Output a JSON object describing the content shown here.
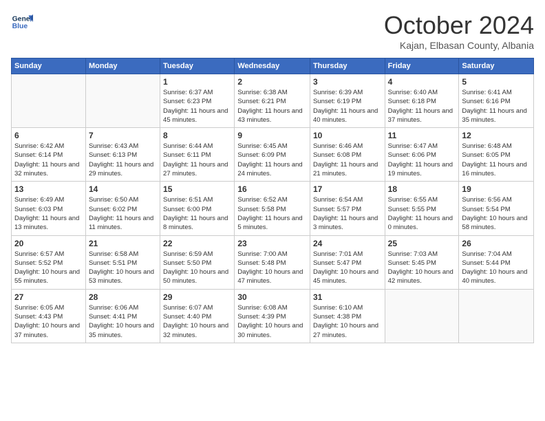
{
  "header": {
    "logo_line1": "General",
    "logo_line2": "Blue",
    "month": "October 2024",
    "location": "Kajan, Elbasan County, Albania"
  },
  "days_of_week": [
    "Sunday",
    "Monday",
    "Tuesday",
    "Wednesday",
    "Thursday",
    "Friday",
    "Saturday"
  ],
  "weeks": [
    [
      {
        "day": "",
        "detail": ""
      },
      {
        "day": "",
        "detail": ""
      },
      {
        "day": "1",
        "detail": "Sunrise: 6:37 AM\nSunset: 6:23 PM\nDaylight: 11 hours and 45 minutes."
      },
      {
        "day": "2",
        "detail": "Sunrise: 6:38 AM\nSunset: 6:21 PM\nDaylight: 11 hours and 43 minutes."
      },
      {
        "day": "3",
        "detail": "Sunrise: 6:39 AM\nSunset: 6:19 PM\nDaylight: 11 hours and 40 minutes."
      },
      {
        "day": "4",
        "detail": "Sunrise: 6:40 AM\nSunset: 6:18 PM\nDaylight: 11 hours and 37 minutes."
      },
      {
        "day": "5",
        "detail": "Sunrise: 6:41 AM\nSunset: 6:16 PM\nDaylight: 11 hours and 35 minutes."
      }
    ],
    [
      {
        "day": "6",
        "detail": "Sunrise: 6:42 AM\nSunset: 6:14 PM\nDaylight: 11 hours and 32 minutes."
      },
      {
        "day": "7",
        "detail": "Sunrise: 6:43 AM\nSunset: 6:13 PM\nDaylight: 11 hours and 29 minutes."
      },
      {
        "day": "8",
        "detail": "Sunrise: 6:44 AM\nSunset: 6:11 PM\nDaylight: 11 hours and 27 minutes."
      },
      {
        "day": "9",
        "detail": "Sunrise: 6:45 AM\nSunset: 6:09 PM\nDaylight: 11 hours and 24 minutes."
      },
      {
        "day": "10",
        "detail": "Sunrise: 6:46 AM\nSunset: 6:08 PM\nDaylight: 11 hours and 21 minutes."
      },
      {
        "day": "11",
        "detail": "Sunrise: 6:47 AM\nSunset: 6:06 PM\nDaylight: 11 hours and 19 minutes."
      },
      {
        "day": "12",
        "detail": "Sunrise: 6:48 AM\nSunset: 6:05 PM\nDaylight: 11 hours and 16 minutes."
      }
    ],
    [
      {
        "day": "13",
        "detail": "Sunrise: 6:49 AM\nSunset: 6:03 PM\nDaylight: 11 hours and 13 minutes."
      },
      {
        "day": "14",
        "detail": "Sunrise: 6:50 AM\nSunset: 6:02 PM\nDaylight: 11 hours and 11 minutes."
      },
      {
        "day": "15",
        "detail": "Sunrise: 6:51 AM\nSunset: 6:00 PM\nDaylight: 11 hours and 8 minutes."
      },
      {
        "day": "16",
        "detail": "Sunrise: 6:52 AM\nSunset: 5:58 PM\nDaylight: 11 hours and 5 minutes."
      },
      {
        "day": "17",
        "detail": "Sunrise: 6:54 AM\nSunset: 5:57 PM\nDaylight: 11 hours and 3 minutes."
      },
      {
        "day": "18",
        "detail": "Sunrise: 6:55 AM\nSunset: 5:55 PM\nDaylight: 11 hours and 0 minutes."
      },
      {
        "day": "19",
        "detail": "Sunrise: 6:56 AM\nSunset: 5:54 PM\nDaylight: 10 hours and 58 minutes."
      }
    ],
    [
      {
        "day": "20",
        "detail": "Sunrise: 6:57 AM\nSunset: 5:52 PM\nDaylight: 10 hours and 55 minutes."
      },
      {
        "day": "21",
        "detail": "Sunrise: 6:58 AM\nSunset: 5:51 PM\nDaylight: 10 hours and 53 minutes."
      },
      {
        "day": "22",
        "detail": "Sunrise: 6:59 AM\nSunset: 5:50 PM\nDaylight: 10 hours and 50 minutes."
      },
      {
        "day": "23",
        "detail": "Sunrise: 7:00 AM\nSunset: 5:48 PM\nDaylight: 10 hours and 47 minutes."
      },
      {
        "day": "24",
        "detail": "Sunrise: 7:01 AM\nSunset: 5:47 PM\nDaylight: 10 hours and 45 minutes."
      },
      {
        "day": "25",
        "detail": "Sunrise: 7:03 AM\nSunset: 5:45 PM\nDaylight: 10 hours and 42 minutes."
      },
      {
        "day": "26",
        "detail": "Sunrise: 7:04 AM\nSunset: 5:44 PM\nDaylight: 10 hours and 40 minutes."
      }
    ],
    [
      {
        "day": "27",
        "detail": "Sunrise: 6:05 AM\nSunset: 4:43 PM\nDaylight: 10 hours and 37 minutes."
      },
      {
        "day": "28",
        "detail": "Sunrise: 6:06 AM\nSunset: 4:41 PM\nDaylight: 10 hours and 35 minutes."
      },
      {
        "day": "29",
        "detail": "Sunrise: 6:07 AM\nSunset: 4:40 PM\nDaylight: 10 hours and 32 minutes."
      },
      {
        "day": "30",
        "detail": "Sunrise: 6:08 AM\nSunset: 4:39 PM\nDaylight: 10 hours and 30 minutes."
      },
      {
        "day": "31",
        "detail": "Sunrise: 6:10 AM\nSunset: 4:38 PM\nDaylight: 10 hours and 27 minutes."
      },
      {
        "day": "",
        "detail": ""
      },
      {
        "day": "",
        "detail": ""
      }
    ]
  ]
}
